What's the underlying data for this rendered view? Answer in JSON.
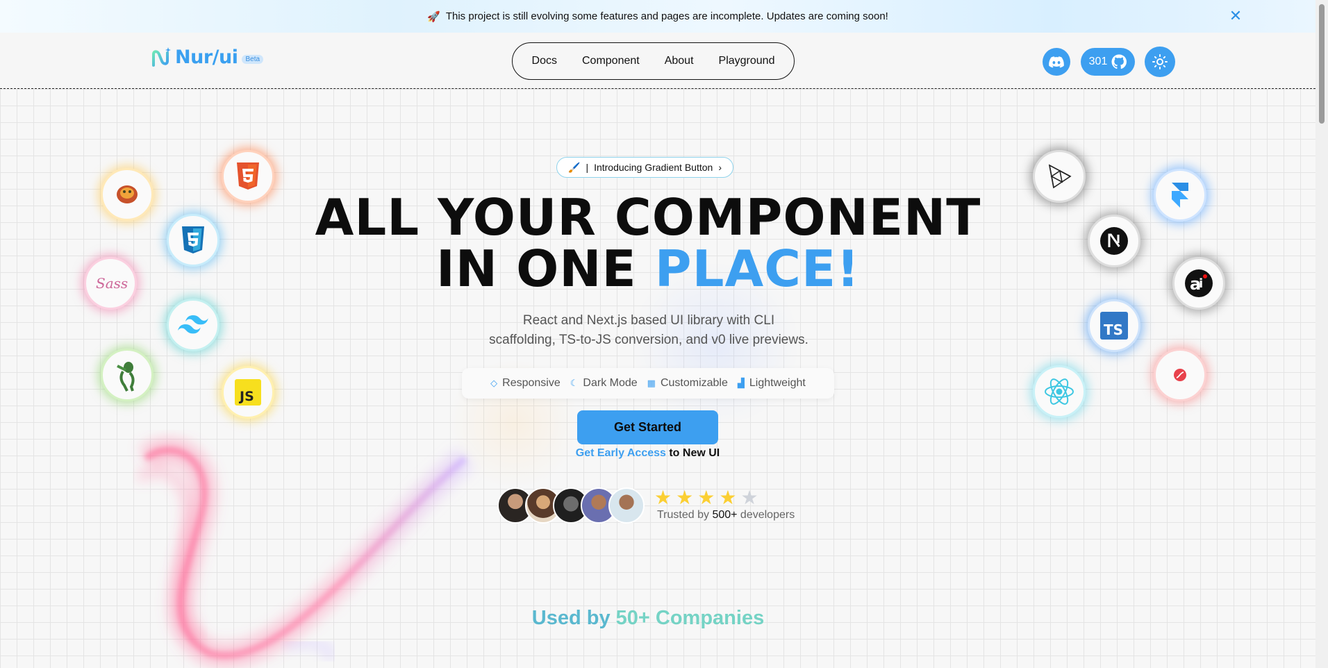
{
  "announcement": {
    "text": "This project is still evolving some features and pages are incomplete. Updates are coming soon!"
  },
  "logo": {
    "name": "Nur/ui",
    "badge": "Beta"
  },
  "nav": {
    "items": [
      "Docs",
      "Component",
      "About",
      "Playground"
    ]
  },
  "header": {
    "github_stars": "301"
  },
  "hero": {
    "pill_label": "Introducing Gradient Button",
    "pill_chevron": "›",
    "pill_separator": "|",
    "headline_line1": "ALL YOUR COMPONENT",
    "headline_line2_prefix": "IN ONE ",
    "headline_line2_accent": "PLACE!",
    "subtitle_line1": "React and Next.js based UI library with CLI",
    "subtitle_line2": "scaffolding, TS-to-JS conversion, and v0 live previews.",
    "features": [
      "Responsive",
      "Dark Mode",
      "Customizable",
      "Lightweight"
    ],
    "cta_label": "Get Started",
    "early_link": "Get Early Access",
    "early_suffix": " to New UI",
    "rating": 4,
    "rating_max": 5,
    "trusted_prefix": "Trusted by ",
    "trusted_count": "500+",
    "trusted_suffix": " developers"
  },
  "companies": {
    "prefix": "Used by ",
    "count": "50+ Companies"
  },
  "tech_icons": {
    "left": [
      "zustand-icon",
      "html5-icon",
      "css3-icon",
      "sass-icon",
      "tailwind-icon",
      "zod-icon",
      "javascript-icon"
    ],
    "right": [
      "threejs-icon",
      "framer-icon",
      "nextjs-icon",
      "aceternity-icon",
      "typescript-icon",
      "react-icon",
      "lottie-icon"
    ]
  },
  "colors": {
    "accent": "#3d9ff0",
    "teal": "#5ab8cf",
    "star": "#fbcf33"
  }
}
